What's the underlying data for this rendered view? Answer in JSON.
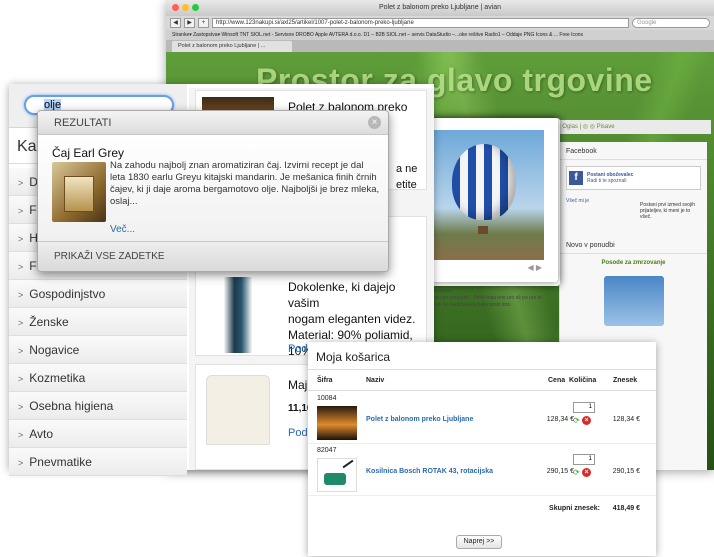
{
  "browser": {
    "window_title": "Polet z balonom preko Ljubljane | avian",
    "url": "http://www.123nakupi.si/axl25/artikel/1007-polet-z-balonom-preko-ljubljane",
    "search_placeholder": "Google",
    "bookmarks": "Stranke▾   Zastopstva▾   Winsoft   TNT   SIOL.net - Servisne   DROBO   Apple   AVTERA d.o.o.   D1 – B2B   SIOL.net – servis   DataStudio –...oke rešitve   Radio1 – Oddaje   PNG Icons & ... Free Icons",
    "tab_title": "Polet z balonom preko Ljubljane | ...",
    "hero_text": "Prostor za glavo trgovine",
    "nav_strip": "| Oglas   |   ◎ ◎ Pisave",
    "facebook_heading": "Facebook",
    "fb_label": "Postani oboževalec",
    "fb_sub": "Radi ti te spoznali",
    "fb_like": "Všeč mi je",
    "fb_small": "Postani prvi izmed svojih prijateljev, ki meni je to všeč.",
    "novo_heading": "Novo v ponudbi",
    "novo_product": "Posode za zmrzovanje",
    "lb_line": "6 mesecev\nvajalo po omaratih\". Polet traja eno uro ali pa uro in\nje tudi še tradicionalni balonarski krst."
  },
  "search": {
    "query_prefix": "olje"
  },
  "sidebar": {
    "title": "Ka",
    "categories": [
      "D",
      "F",
      "H",
      "F",
      "Gospodinjstvo",
      "Ženske",
      "Nogavice",
      "Kozmetika",
      "Osebna higiena",
      "Avto",
      "Pnevmatike"
    ]
  },
  "products": {
    "p1_name": "Polet z balonom preko",
    "p2_name_lines": "Dokolenke, ki dajejo vašim\nnogam eleganten videz.\nMaterial: 90% poliamid,\n10% elastan, več barv.",
    "p2_link": "Podrobnosti",
    "p3_name": "Maji",
    "p3_price": "11,16",
    "p3_link": "Podr",
    "p1_peek_a": "a ne",
    "p1_peek_b": "etite"
  },
  "popup": {
    "header": "REZULTATI",
    "result_title": "Čaj Earl Grey",
    "result_desc": "Na zahodu najbolj znan aromatiziran čaj. Izvirni recept je dal leta 1830 earlu Greyu kitajski mandarin. Je mešanica finih črnih čajev, ki ji daje aroma bergamotovo olje. Najboljši je brez mleka, oslaj...",
    "more_link": "Več...",
    "footer": "PRIKAŽI VSE ZADETKE"
  },
  "cart": {
    "title": "Moja košarica",
    "columns": {
      "sifra": "Šifra",
      "naziv": "Naziv",
      "cena": "Cena",
      "kolicina": "Količina",
      "znesek": "Znesek"
    },
    "rows": [
      {
        "sku": "10084",
        "name": "Polet z balonom preko Ljubljane",
        "price": "128,34 €",
        "qty": "1",
        "total": "128,34 €"
      },
      {
        "sku": "82047",
        "name": "Kosilnica Bosch ROTAK 43, rotacijska",
        "price": "290,15 €",
        "qty": "1",
        "total": "290,15 €"
      }
    ],
    "total_label": "Skupni znesek:",
    "total_value": "418,49 €",
    "next_button": "Naprej >>"
  },
  "colors": {
    "accent_blue": "#2a6ab0",
    "fb_blue": "#3b5998",
    "delete_red": "#d62b2b",
    "refresh_green": "#3a9d2a"
  }
}
